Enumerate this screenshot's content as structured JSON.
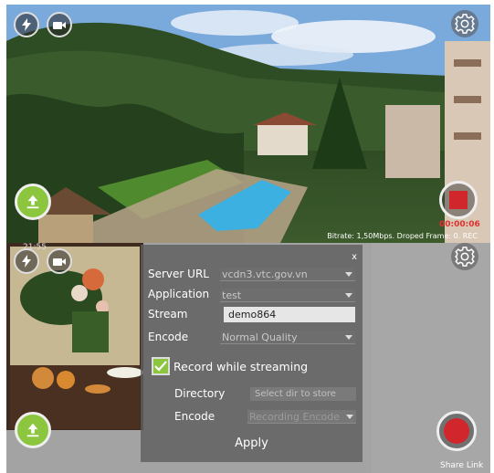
{
  "top": {
    "status_text": "Bitrate: 1,50Mbps. Droped Frame: 0. REC",
    "timer": "00:00:06",
    "icons": [
      "flash-icon",
      "camera-switch-icon",
      "settings-icon",
      "upload-icon",
      "stop-record-icon"
    ]
  },
  "bottom": {
    "status_left": "21:55",
    "share_link": "Share Link",
    "icons": [
      "flash-icon",
      "camera-switch-icon",
      "settings-icon",
      "upload-icon",
      "record-icon"
    ]
  },
  "dialog": {
    "close": "x",
    "server_url_label": "Server URL",
    "server_url_value": "vcdn3.vtc.gov.vn",
    "application_label": "Application",
    "application_value": "test",
    "stream_label": "Stream",
    "stream_value": "demo864",
    "encode_label": "Encode",
    "encode_value": "Normal Quality",
    "record_label": "Record while streaming",
    "record_checked": true,
    "directory_label": "Directory",
    "directory_placeholder": "Select dir to store",
    "rec_encode_label": "Encode",
    "rec_encode_value": "Recording Encode",
    "apply_label": "Apply"
  },
  "colors": {
    "accent_green": "#8cc63f",
    "record_red": "#d0262c"
  }
}
